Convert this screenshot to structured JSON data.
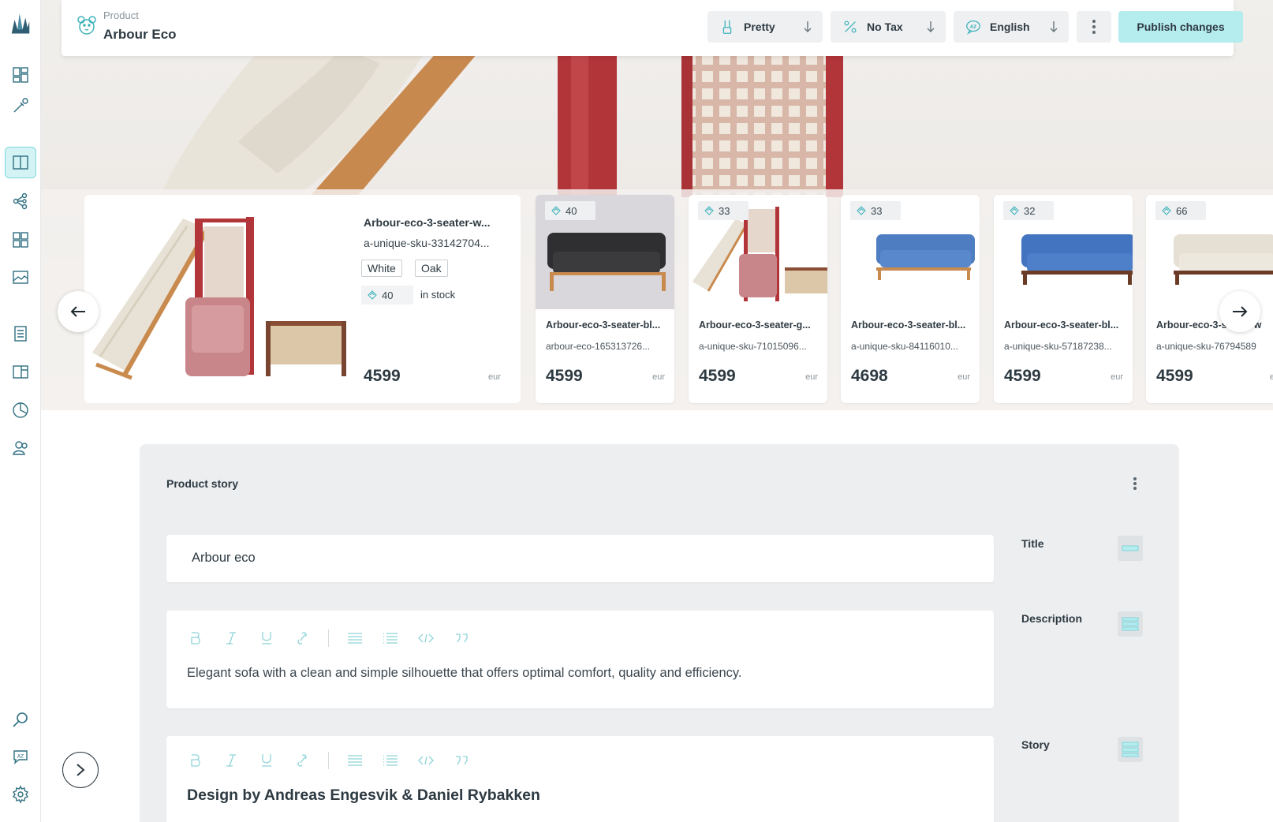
{
  "header": {
    "kicker": "Product",
    "title": "Arbour Eco",
    "selects": [
      {
        "label": "Pretty",
        "icon": "brush-icon"
      },
      {
        "label": "No Tax",
        "icon": "percent-icon"
      },
      {
        "label": "English",
        "icon": "language-icon"
      }
    ],
    "more_icon": "kebab-icon",
    "publish_label": "Publish changes"
  },
  "sidebar": {
    "logo": "crystal-logo",
    "items": [
      "dashboard-icon",
      "pipette-icon",
      "catalogue-icon",
      "topics-icon",
      "grid-icon",
      "image-icon",
      "document-icon",
      "shapes-icon",
      "analytics-icon",
      "users-icon",
      "search-icon",
      "translate-icon",
      "settings-icon"
    ],
    "active": "catalogue-icon"
  },
  "featured": {
    "name": "Arbour-eco-3-seater-w...",
    "sku": "a-unique-sku-33142704...",
    "attributes": [
      "White",
      "Oak"
    ],
    "stock": "40",
    "stock_label": "in stock",
    "price": "4599",
    "currency": "eur"
  },
  "variants": [
    {
      "stock": "40",
      "name": "Arbour-eco-3-seater-bl...",
      "sku": "arbour-eco-165313726...",
      "price": "4599",
      "currency": "eur"
    },
    {
      "stock": "33",
      "name": "Arbour-eco-3-seater-g...",
      "sku": "a-unique-sku-71015096...",
      "price": "4599",
      "currency": "eur"
    },
    {
      "stock": "33",
      "name": "Arbour-eco-3-seater-bl...",
      "sku": "a-unique-sku-84116010...",
      "price": "4698",
      "currency": "eur"
    },
    {
      "stock": "32",
      "name": "Arbour-eco-3-seater-bl...",
      "sku": "a-unique-sku-57187238...",
      "price": "4599",
      "currency": "eur"
    },
    {
      "stock": "66",
      "name": "Arbour-eco-3-seater-w",
      "sku": "a-unique-sku-76794589",
      "price": "4599",
      "currency": "e"
    }
  ],
  "story": {
    "heading": "Product story",
    "title_value": "Arbour eco",
    "description_value": "Elegant sofa with a clean and simple silhouette that offers optimal comfort, quality and efficiency.",
    "story_value": "Design by Andreas Engesvik & Daniel Rybakken",
    "components": [
      {
        "label": "Title",
        "icon": "single-line-icon"
      },
      {
        "label": "Description",
        "icon": "rich-text-icon"
      },
      {
        "label": "Story",
        "icon": "paragraph-collection-icon"
      }
    ],
    "toolbar": [
      "bold-icon",
      "italic-icon",
      "underline-icon",
      "link-icon",
      "ordered-list-icon",
      "unordered-list-icon",
      "code-icon",
      "quote-icon"
    ]
  },
  "colors": {
    "accent": "#b5ecee",
    "accent_border": "#7fd6da",
    "icon_teal": "#3fb3bb",
    "text": "#2e3a42",
    "panel": "#eceef0"
  }
}
